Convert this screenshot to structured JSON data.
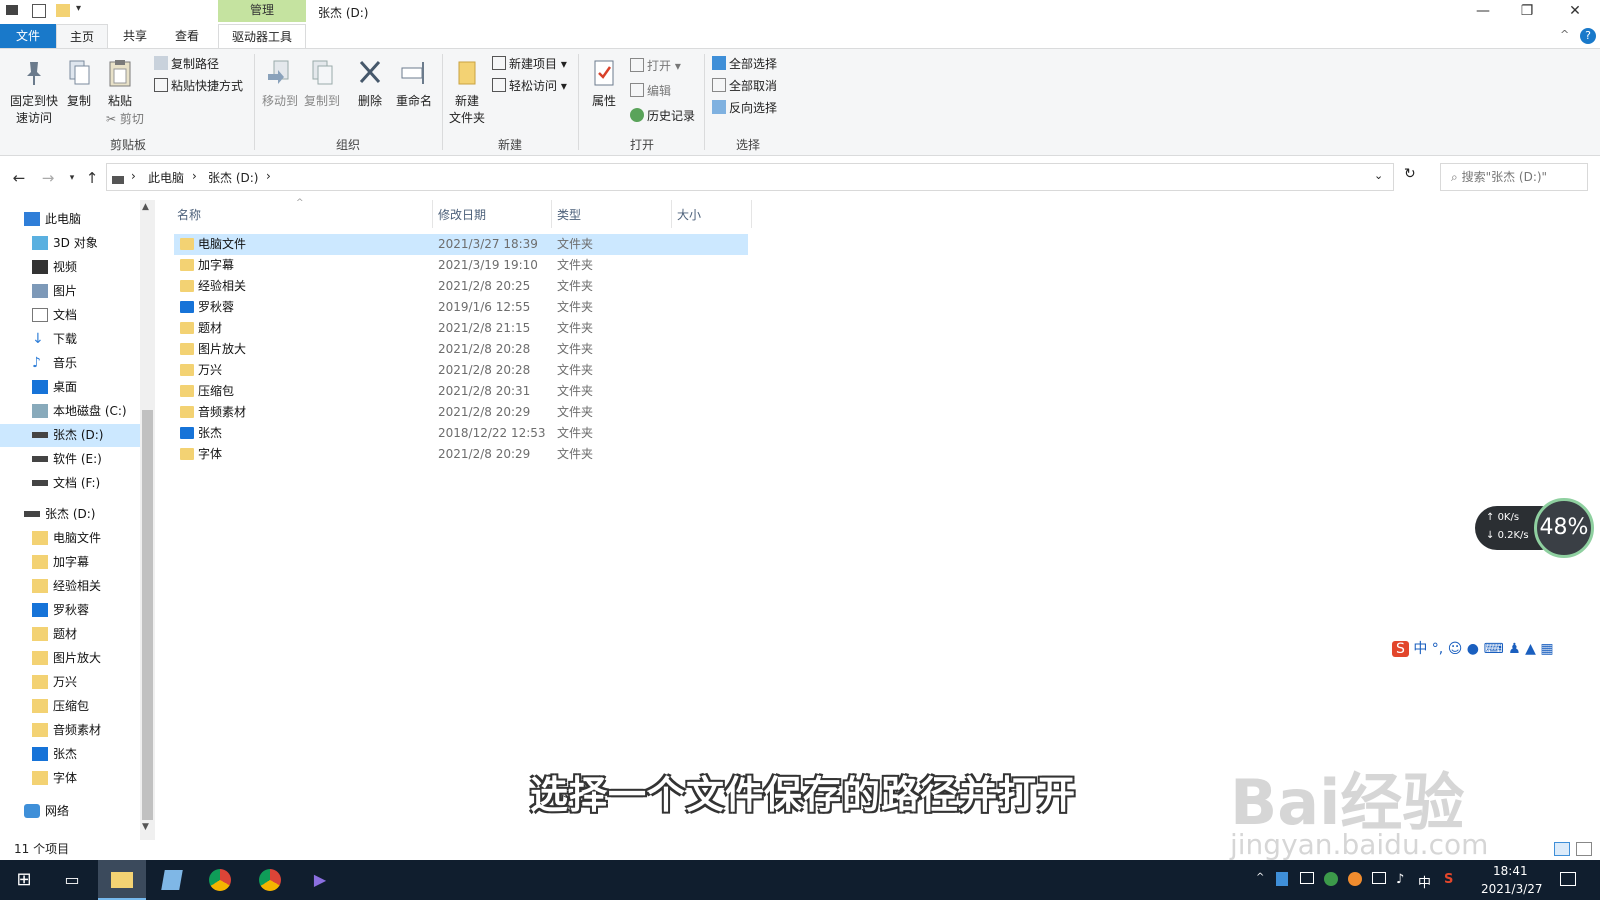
{
  "window": {
    "title": "张杰 (D:)",
    "context_tab": "管理",
    "minimize": "—",
    "maximize": "❐",
    "close": "✕"
  },
  "tabs": {
    "file": "文件",
    "home": "主页",
    "share": "共享",
    "view": "查看",
    "drive_tools": "驱动器工具"
  },
  "ribbon": {
    "clipboard": {
      "pin": "固定到快\n速访问",
      "pin_l1": "固定到快",
      "pin_l2": "速访问",
      "copy": "复制",
      "paste": "粘贴",
      "copy_path": "复制路径",
      "paste_shortcut": "粘贴快捷方式",
      "cut": "剪切",
      "group": "剪贴板"
    },
    "organize": {
      "move_to": "移动到",
      "copy_to": "复制到",
      "delete": "删除",
      "rename": "重命名",
      "group": "组织"
    },
    "new": {
      "new_folder_l1": "新建",
      "new_folder_l2": "文件夹",
      "new_item": "新建项目",
      "easy_access": "轻松访问",
      "group": "新建"
    },
    "open": {
      "properties": "属性",
      "open": "打开",
      "edit": "编辑",
      "history": "历史记录",
      "group": "打开"
    },
    "select": {
      "select_all": "全部选择",
      "select_none": "全部取消",
      "invert": "反向选择",
      "group": "选择"
    }
  },
  "address": {
    "crumbs": [
      "此电脑",
      "张杰 (D:)"
    ],
    "search_placeholder": "搜索\"张杰 (D:)\""
  },
  "nav": {
    "quick": [
      {
        "label": "此电脑"
      },
      {
        "label": "3D 对象"
      },
      {
        "label": "视频"
      },
      {
        "label": "图片"
      },
      {
        "label": "文档"
      },
      {
        "label": "下载"
      },
      {
        "label": "音乐"
      },
      {
        "label": "桌面"
      },
      {
        "label": "本地磁盘 (C:)"
      },
      {
        "label": "张杰 (D:)"
      },
      {
        "label": "软件 (E:)"
      },
      {
        "label": "文档 (F:)"
      }
    ],
    "drive": [
      {
        "label": "张杰 (D:)"
      },
      {
        "label": "电脑文件"
      },
      {
        "label": "加字幕"
      },
      {
        "label": "经验相关"
      },
      {
        "label": "罗秋蓉"
      },
      {
        "label": "题材"
      },
      {
        "label": "图片放大"
      },
      {
        "label": "万兴"
      },
      {
        "label": "压缩包"
      },
      {
        "label": "音频素材"
      },
      {
        "label": "张杰"
      },
      {
        "label": "字体"
      }
    ],
    "network": "网络"
  },
  "columns": {
    "name": "名称",
    "modified": "修改日期",
    "type": "类型",
    "size": "大小"
  },
  "files": [
    {
      "name": "电脑文件",
      "date": "2021/3/27 18:39",
      "type": "文件夹",
      "icon": "folder"
    },
    {
      "name": "加字幕",
      "date": "2021/3/19 19:10",
      "type": "文件夹",
      "icon": "folder"
    },
    {
      "name": "经验相关",
      "date": "2021/2/8 20:25",
      "type": "文件夹",
      "icon": "folder"
    },
    {
      "name": "罗秋蓉",
      "date": "2019/1/6 12:55",
      "type": "文件夹",
      "icon": "folder-blue"
    },
    {
      "name": "题材",
      "date": "2021/2/8 21:15",
      "type": "文件夹",
      "icon": "folder"
    },
    {
      "name": "图片放大",
      "date": "2021/2/8 20:28",
      "type": "文件夹",
      "icon": "folder"
    },
    {
      "name": "万兴",
      "date": "2021/2/8 20:28",
      "type": "文件夹",
      "icon": "folder"
    },
    {
      "name": "压缩包",
      "date": "2021/2/8 20:31",
      "type": "文件夹",
      "icon": "folder"
    },
    {
      "name": "音频素材",
      "date": "2021/2/8 20:29",
      "type": "文件夹",
      "icon": "folder"
    },
    {
      "name": "张杰",
      "date": "2018/12/22 12:53",
      "type": "文件夹",
      "icon": "folder-blue"
    },
    {
      "name": "字体",
      "date": "2021/2/8 20:29",
      "type": "文件夹",
      "icon": "folder"
    }
  ],
  "status": {
    "count": "11 个项目"
  },
  "net_widget": {
    "up": "0K/s",
    "down": "0.2K/s",
    "percent": "48%"
  },
  "ime": {
    "mode": "中"
  },
  "subtitle": "选择一个文件保存的路径并打开",
  "watermark": {
    "brand": "Bai经验",
    "url": "jingyan.baidu.com"
  },
  "taskbar": {
    "time": "18:41",
    "date": "2021/3/27",
    "ime": "中"
  },
  "colors": {
    "accent": "#1979ca",
    "selection": "#cce8ff",
    "folder": "#f3d273",
    "taskbar": "#101e2e"
  }
}
